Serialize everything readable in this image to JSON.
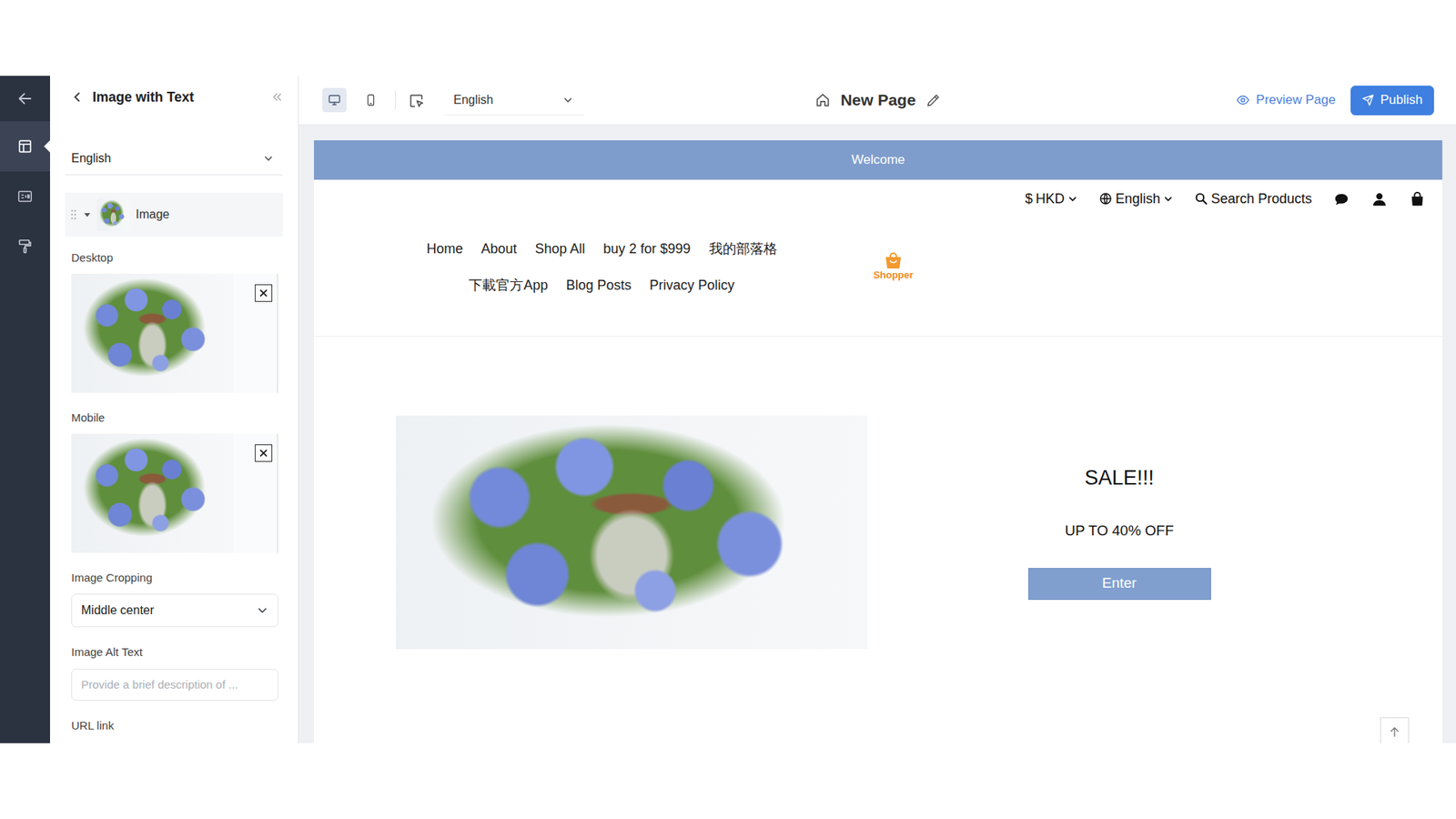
{
  "rail": {
    "items": [
      {
        "selected": true
      },
      {
        "selected": false
      },
      {
        "selected": false
      }
    ]
  },
  "panel": {
    "title": "Image with Text",
    "language": "English",
    "layer": {
      "label": "Image",
      "expanded": true
    },
    "desktop_label": "Desktop",
    "mobile_label": "Mobile",
    "cropping": {
      "label": "Image Cropping",
      "value": "Middle center"
    },
    "alt_text": {
      "label": "Image Alt Text",
      "placeholder": "Provide a brief description of ..."
    },
    "url": {
      "label": "URL link"
    }
  },
  "toolbar": {
    "devices": [
      {
        "selected": true
      },
      {
        "selected": false
      }
    ],
    "language": "English",
    "page_title": "New Page",
    "preview": "Preview Page",
    "publish": "Publish"
  },
  "preview": {
    "announcement": "Welcome",
    "currency_symbol": "$",
    "currency": "HKD",
    "language": "English",
    "search": "Search Products",
    "nav": [
      "Home",
      "About",
      "Shop All",
      "buy 2 for $999",
      "我的部落格",
      "下載官方App",
      "Blog Posts",
      "Privacy Policy"
    ],
    "logo": "Shopper",
    "banner": {
      "title": "SALE!!!",
      "subtitle": "UP TO 40% OFF",
      "button": "Enter"
    }
  }
}
